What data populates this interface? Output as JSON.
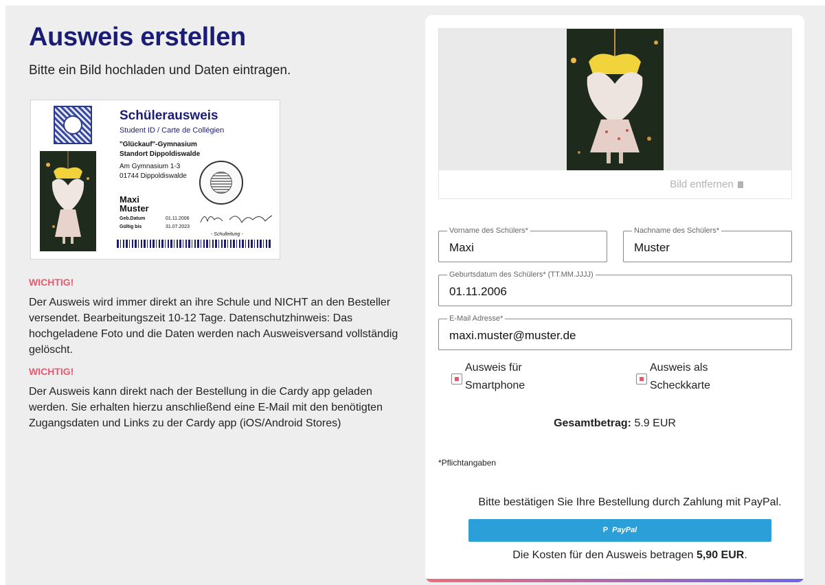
{
  "header": {
    "title": "Ausweis erstellen",
    "subtitle": "Bitte ein Bild hochladen und Daten eintragen."
  },
  "id_card": {
    "title": "Schülerausweis",
    "subtitle": "Student ID / Carte de Collégien",
    "school_line1": "\"Glückauf\"-Gymnasium",
    "school_line2": "Standort Dippoldiswalde",
    "address_line1": "Am Gymnasium 1-3",
    "address_line2": "01744 Dippoldiswalde",
    "first_name": "Maxi",
    "last_name": "Muster",
    "birth_label": "Geb.Datum",
    "birth_value": "01.11.2006",
    "valid_label": "Gültig bis",
    "valid_value": "31.07.2023",
    "signature_caption": "- Schulleitung -"
  },
  "info": {
    "warning1": "WICHTIG!",
    "text1": "Der Ausweis wird immer direkt an ihre Schule und NICHT an den Besteller versendet. Bearbeitungszeit 10-12 Tage. Datenschutzhinweis: Das hochgeladene Foto und die Daten werden nach Ausweisversand vollständig gelöscht.",
    "warning2": "WICHTIG!",
    "text2": "Der Ausweis kann direkt nach der Bestellung in die Cardy app geladen werden. Sie erhalten hierzu anschließend eine E-Mail mit den benötigten Zugangsdaten und Links zu der Cardy app (iOS/Android Stores)"
  },
  "form": {
    "remove_image": "Bild entfernen",
    "firstname_label": "Vorname des Schülers*",
    "firstname_value": "Maxi",
    "lastname_label": "Nachname des Schülers*",
    "lastname_value": "Muster",
    "birthdate_label": "Geburtsdatum des Schülers* (TT.MM.JJJJ)",
    "birthdate_value": "01.11.2006",
    "email_label": "E-Mail Adresse*",
    "email_value": "maxi.muster@muster.de",
    "option1_line1": "Ausweis für",
    "option1_line2": "Smartphone",
    "option2_line1": "Ausweis als",
    "option2_line2": "Scheckkarte",
    "total_label": "Gesamtbetrag:",
    "total_value": "5.9 EUR",
    "required_note": "*Pflichtangaben",
    "confirm_text": "Bitte bestätigen Sie Ihre Bestellung durch Zahlung mit PayPal.",
    "paypal_label": "PayPal",
    "cost_text": "Die Kosten für den Ausweis betragen",
    "cost_value": "5,90 EUR",
    "cost_suffix": "."
  },
  "colors": {
    "title": "#1b1d74",
    "warning": "#e8586e",
    "paypal": "#2a9fd8"
  },
  "icons": [
    "trash-icon",
    "paypal-logo-icon",
    "crest-icon",
    "stamp-icon"
  ]
}
